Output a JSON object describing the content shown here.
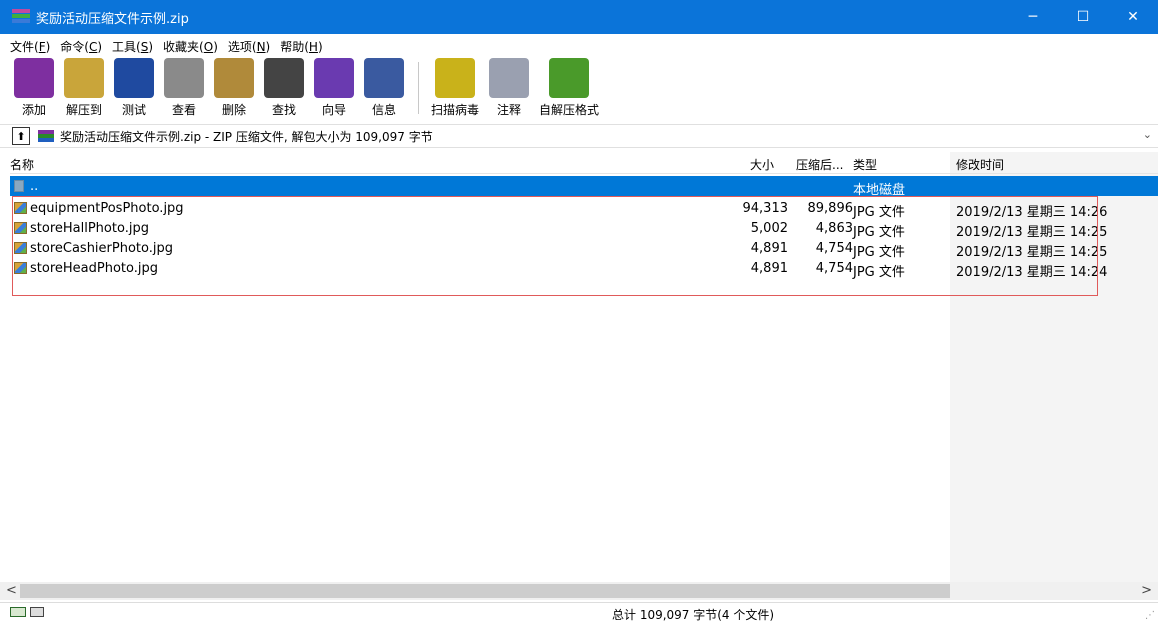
{
  "window": {
    "title": "奖励活动压缩文件示例.zip",
    "buttons": {
      "minimize": "─",
      "maximize": "☐",
      "close": "✕"
    }
  },
  "menu": [
    {
      "label": "文件(",
      "key": "F",
      "end": ")"
    },
    {
      "label": "命令(",
      "key": "C",
      "end": ")"
    },
    {
      "label": "工具(",
      "key": "S",
      "end": ")"
    },
    {
      "label": "收藏夹(",
      "key": "O",
      "end": ")"
    },
    {
      "label": "选项(",
      "key": "N",
      "end": ")"
    },
    {
      "label": "帮助(",
      "key": "H",
      "end": ")"
    }
  ],
  "toolbar": [
    {
      "label": "添加",
      "icon": "add-icon",
      "color": "#7e2fa0"
    },
    {
      "label": "解压到",
      "icon": "extract-to-icon",
      "color": "#c9a53a"
    },
    {
      "label": "测试",
      "icon": "test-icon",
      "color": "#1f4aa0"
    },
    {
      "label": "查看",
      "icon": "view-icon",
      "color": "#8a8a8a"
    },
    {
      "label": "删除",
      "icon": "delete-icon",
      "color": "#b08a3a"
    },
    {
      "label": "查找",
      "icon": "find-icon",
      "color": "#444444"
    },
    {
      "label": "向导",
      "icon": "wizard-icon",
      "color": "#6a3ab0"
    },
    {
      "label": "信息",
      "icon": "info-icon",
      "color": "#3a5aa0"
    },
    {
      "label": "扫描病毒",
      "icon": "scan-virus-icon",
      "color": "#c9b21a"
    },
    {
      "label": "注释",
      "icon": "comment-icon",
      "color": "#9aa0b0"
    },
    {
      "label": "自解压格式",
      "icon": "sfx-icon",
      "color": "#4a9a2a"
    }
  ],
  "address": {
    "up_label": "⬆",
    "path": "奖励活动压缩文件示例.zip - ZIP 压缩文件, 解包大小为 109,097 字节",
    "dropdown": "⌄"
  },
  "columns": {
    "name": "名称",
    "size": "大小",
    "packed": "压缩后...",
    "type": "类型",
    "modified": "修改时间"
  },
  "parent_row": {
    "name": "..",
    "type": "本地磁盘"
  },
  "files": [
    {
      "name": "equipmentPosPhoto.jpg",
      "size": "94,313",
      "packed": "89,896",
      "type": "JPG 文件",
      "modified": "2019/2/13 星期三 14:26"
    },
    {
      "name": "storeHallPhoto.jpg",
      "size": "5,002",
      "packed": "4,863",
      "type": "JPG 文件",
      "modified": "2019/2/13 星期三 14:25"
    },
    {
      "name": "storeCashierPhoto.jpg",
      "size": "4,891",
      "packed": "4,754",
      "type": "JPG 文件",
      "modified": "2019/2/13 星期三 14:25"
    },
    {
      "name": "storeHeadPhoto.jpg",
      "size": "4,891",
      "packed": "4,754",
      "type": "JPG 文件",
      "modified": "2019/2/13 星期三 14:24"
    }
  ],
  "scrollbar": {
    "left": "<",
    "right": ">"
  },
  "status": {
    "text": "总计 109,097 字节(4 个文件)"
  }
}
